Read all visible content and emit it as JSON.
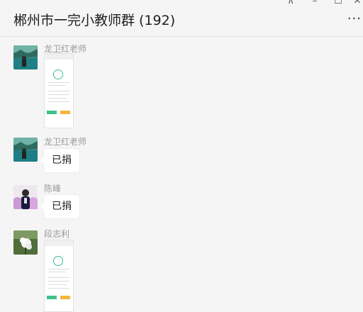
{
  "window": {
    "title": "郴州市一完小教师群 (192)",
    "controls": {
      "pin": "⊼",
      "minimize": "–",
      "maximize": "☐",
      "close": "✕"
    },
    "more": "···"
  },
  "messages": [
    {
      "sender": "龙卫红老师",
      "type": "image",
      "avatar_icon": "lake-landscape-avatar",
      "avatar_color": "#3a8a8a"
    },
    {
      "sender": "龙卫红老师",
      "type": "text",
      "text": "已捐",
      "avatar_icon": "lake-landscape-avatar",
      "avatar_color": "#3a8a8a"
    },
    {
      "sender": "陈峰",
      "type": "text",
      "text": "已捐",
      "avatar_icon": "person-portrait-avatar",
      "avatar_color": "#c99ad6"
    },
    {
      "sender": "段志利",
      "type": "image",
      "avatar_icon": "flower-avatar",
      "avatar_color": "#4f6e3a"
    }
  ],
  "colors": {
    "background": "#f5f5f5",
    "bubble": "#ffffff",
    "sender_name": "#9a9a9a",
    "success_green": "#3fbf8a",
    "button_yellow": "#f4b63c"
  }
}
